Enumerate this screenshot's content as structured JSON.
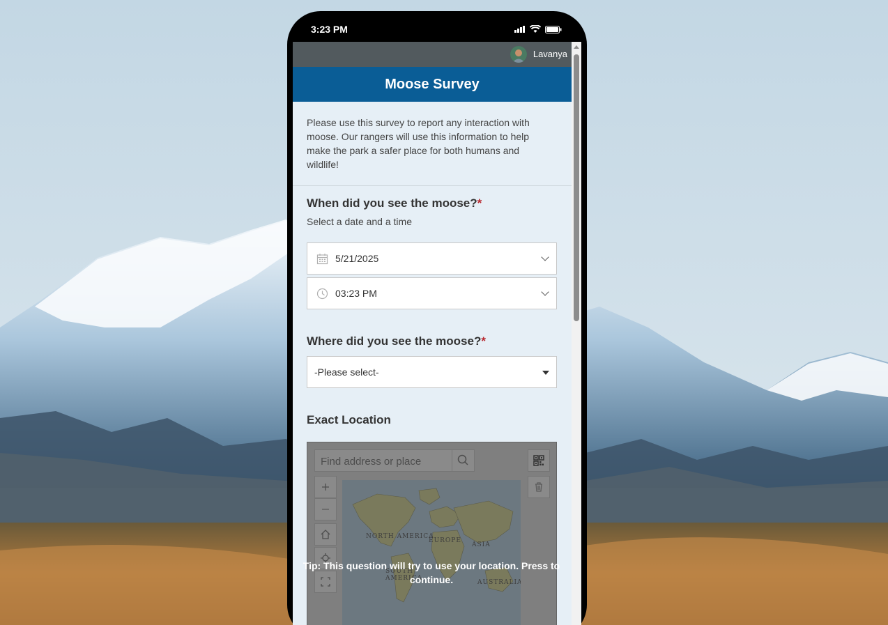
{
  "status_bar": {
    "time": "3:23 PM"
  },
  "user": {
    "name": "Lavanya"
  },
  "form": {
    "title": "Moose Survey",
    "intro": "Please use this survey to report any interaction with moose. Our rangers will use this information to help make the park a safer place for both humans and wildlife!"
  },
  "questions": {
    "when": {
      "label": "When did you see the moose?",
      "required_mark": "*",
      "hint": "Select a date and a time",
      "date_value": "5/21/2025",
      "time_value": "03:23 PM"
    },
    "where": {
      "label": "Where did you see the moose?",
      "required_mark": "*",
      "select_value": "-Please select-"
    },
    "location": {
      "label": "Exact Location",
      "search_placeholder": "Find address or place",
      "tip": "Tip: This question will try to use your location. Press to continue.",
      "map_labels": {
        "north_america": "NORTH AMERICA",
        "europe": "EUROPE",
        "asia": "ASIA",
        "south_america": "SOUTH AMERICA",
        "australia": "AUSTRALIA"
      }
    }
  },
  "colors": {
    "header": "#0a5d96",
    "user_bar": "#525a5e",
    "required": "#b8282f"
  }
}
